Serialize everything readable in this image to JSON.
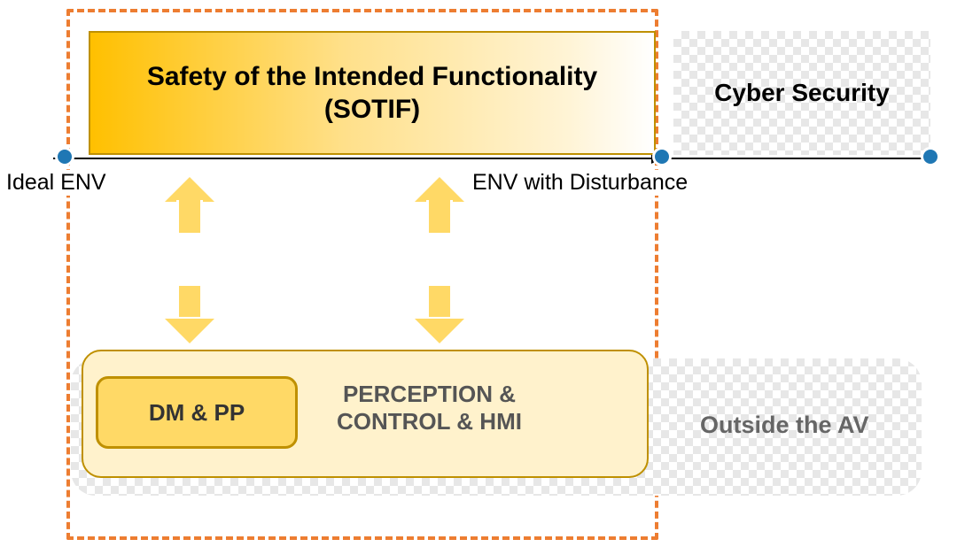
{
  "boxes": {
    "sotif": {
      "line1": "Safety of the Intended Functionality",
      "line2": "(SOTIF)"
    },
    "cyber": "Cyber Security",
    "outside": "Outside the AV",
    "perception": {
      "line1": "PERCEPTION &",
      "line2": "CONTROL & HMI"
    },
    "dm": "DM & PP"
  },
  "axis": {
    "left_label": "Ideal ENV",
    "right_label": "ENV with Disturbance"
  },
  "colors": {
    "accent_orange": "#ed7d31",
    "gold": "#ffc000",
    "gold_border": "#bf9000",
    "dot_blue": "#1f77b4"
  }
}
